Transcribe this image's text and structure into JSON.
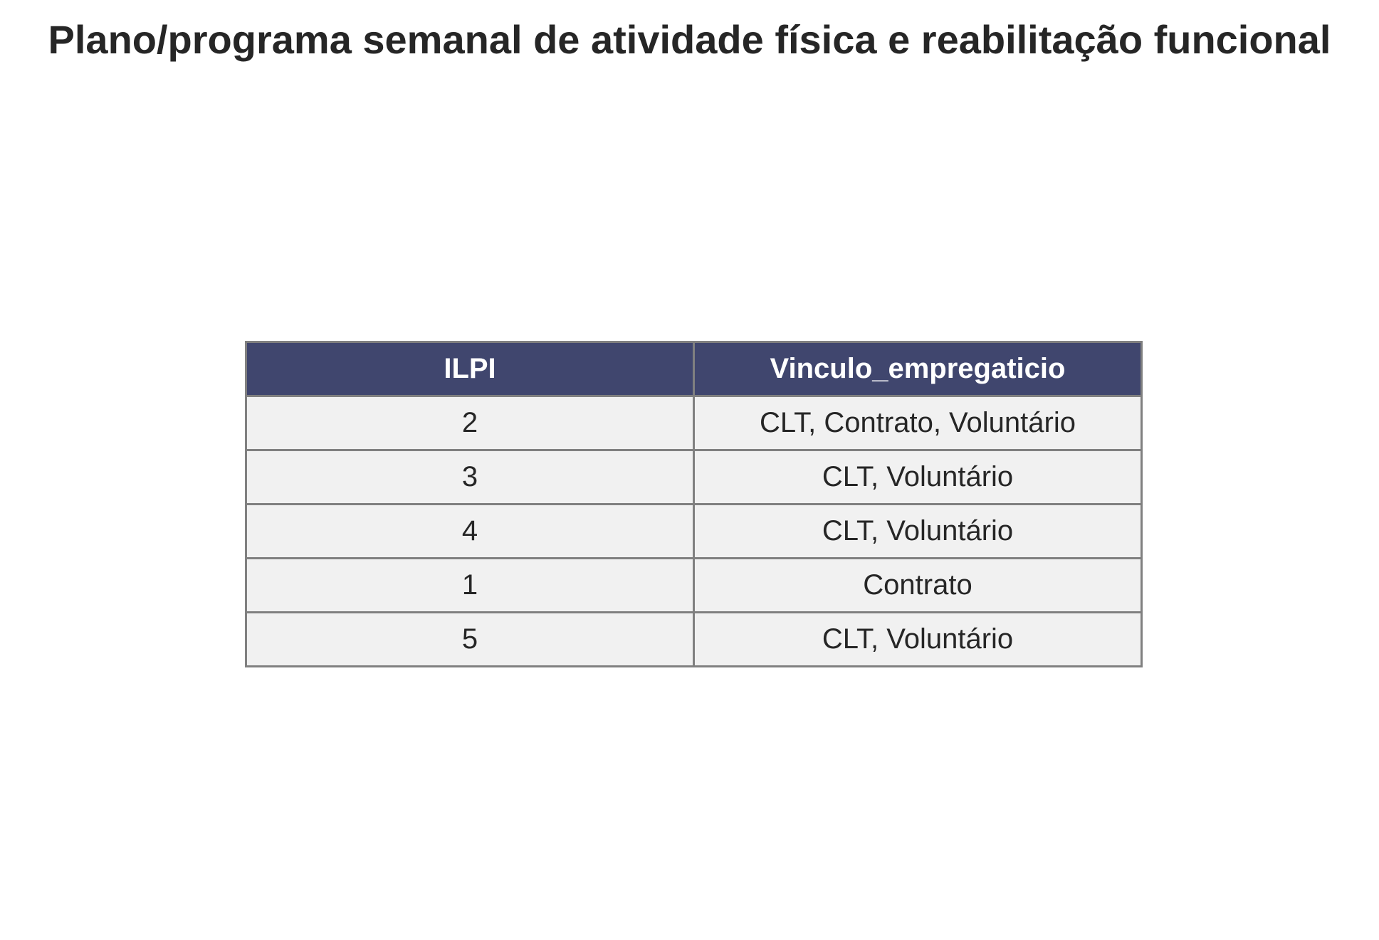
{
  "chart_data": {
    "type": "table",
    "title": "Plano/programa semanal de atividade física e reabilitação funcional",
    "columns": [
      "ILPI",
      "Vinculo_empregaticio"
    ],
    "rows": [
      [
        "2",
        "CLT, Contrato, Voluntário"
      ],
      [
        "3",
        "CLT, Voluntário"
      ],
      [
        "4",
        "CLT, Voluntário"
      ],
      [
        "1",
        "Contrato"
      ],
      [
        "5",
        "CLT, Voluntário"
      ]
    ],
    "colors": {
      "header_background": "#40466e",
      "header_text": "#ffffff",
      "cell_background": "#f1f1f1",
      "border": "#808080"
    }
  }
}
